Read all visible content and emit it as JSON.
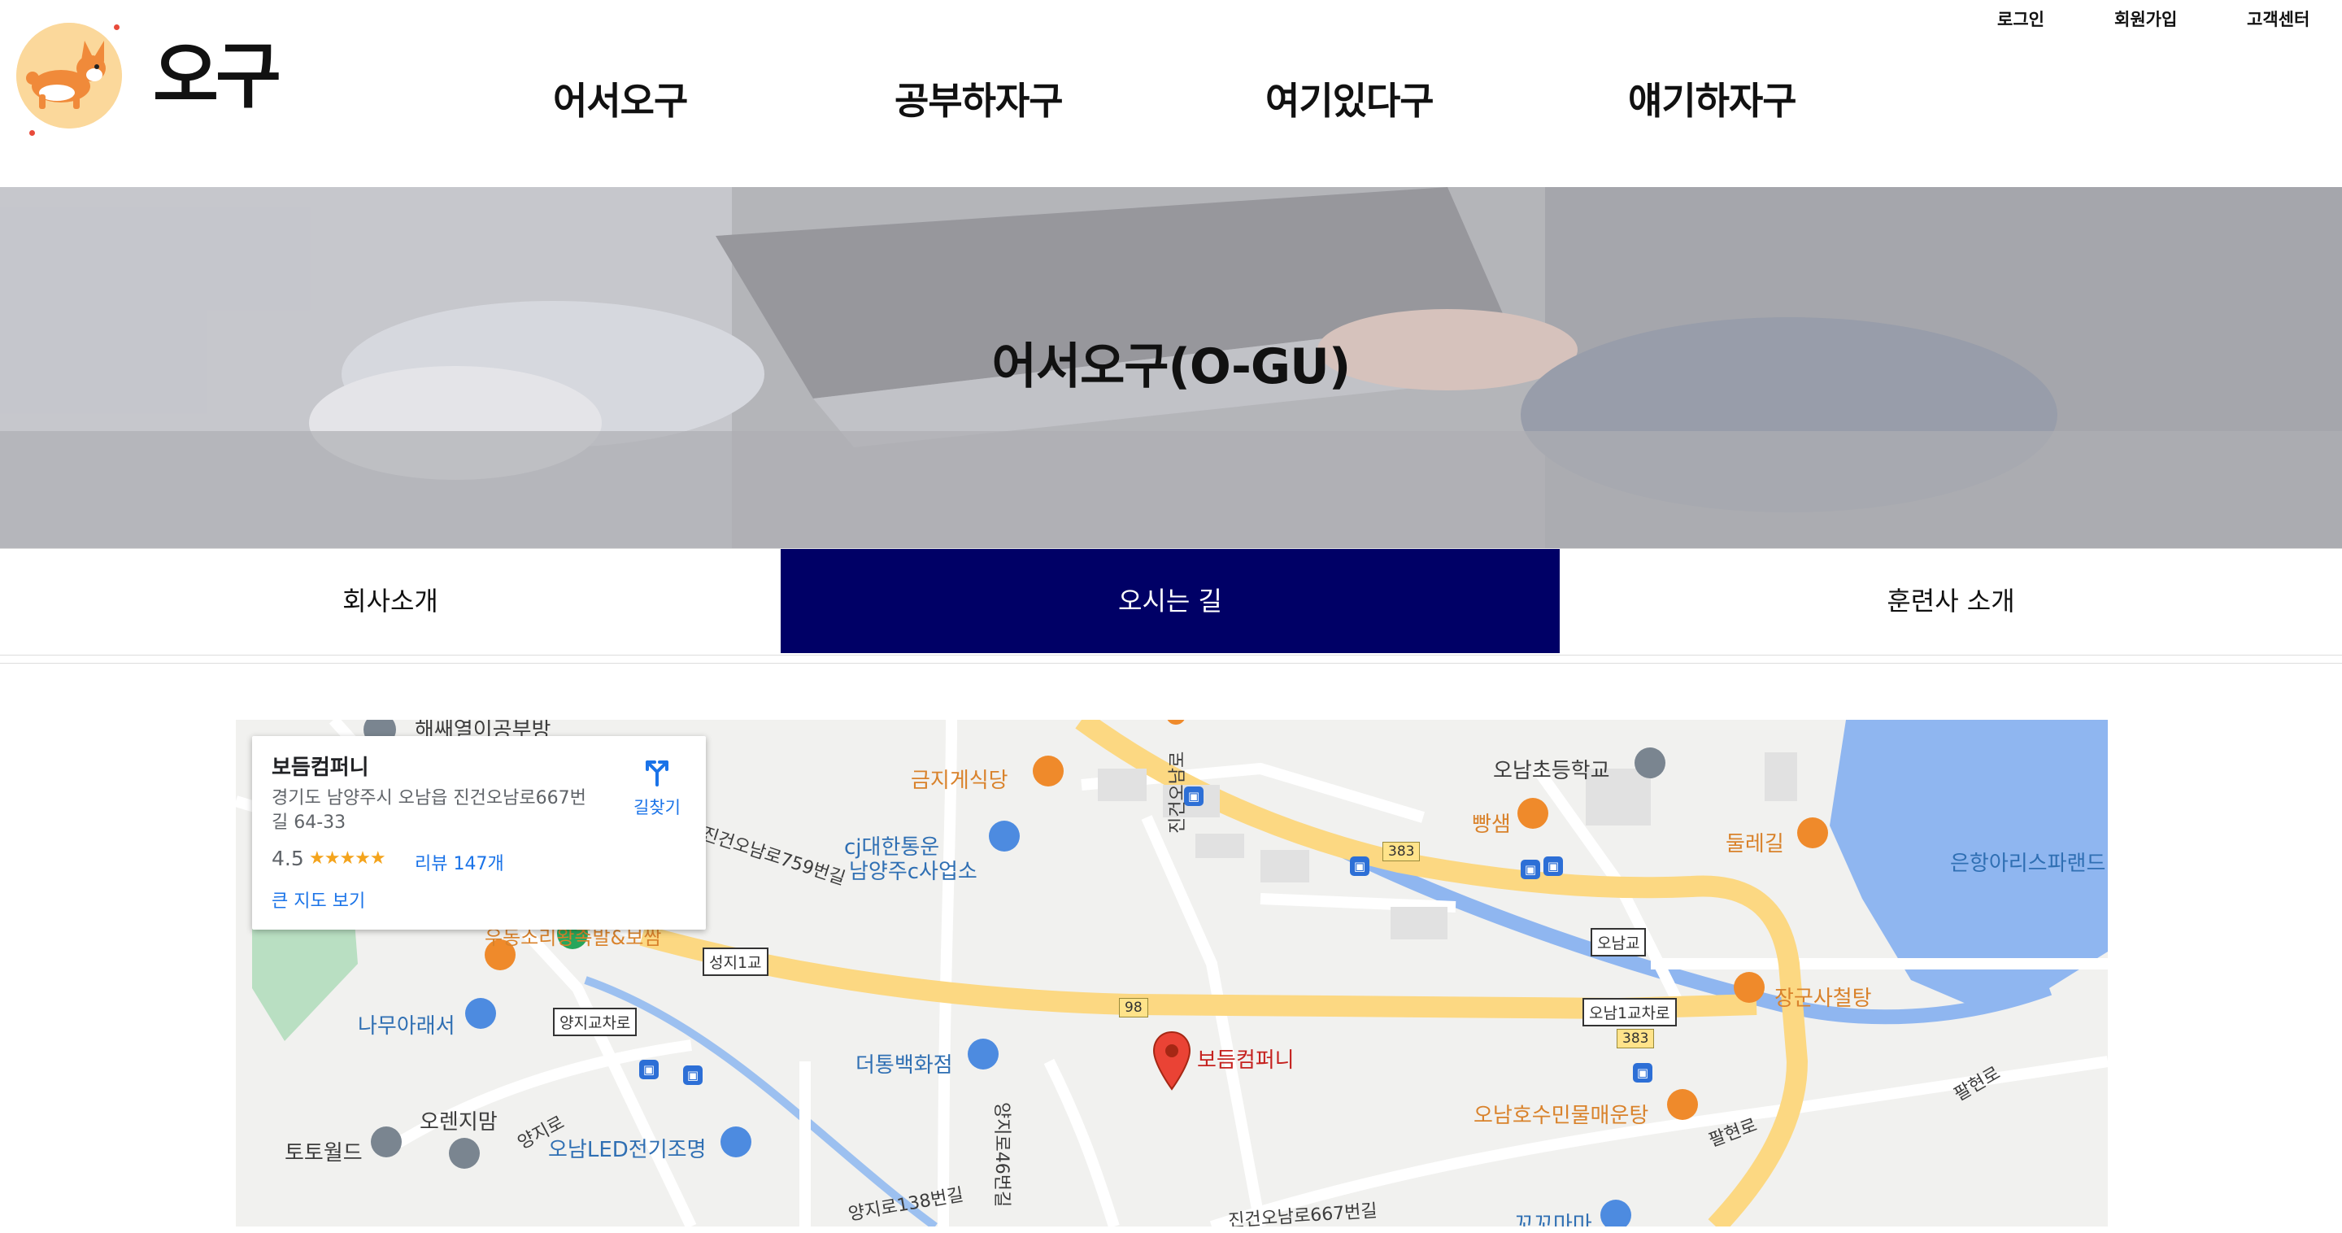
{
  "header": {
    "logo_text": "오구",
    "top_links": [
      "로그인",
      "회원가입",
      "고객센터"
    ],
    "nav": [
      "어서오구",
      "공부하자구",
      "여기있다구",
      "얘기하자구"
    ]
  },
  "banner": {
    "title": "어서오구(O-GU)"
  },
  "tabs": {
    "items": [
      "회사소개",
      "오시는 길",
      "훈련사 소개"
    ],
    "active_index": 1
  },
  "map": {
    "place_card": {
      "name": "보듬컴퍼니",
      "address": "경기도 남양주시 오남읍 진건오남로667번길 64-33",
      "rating": "4.5",
      "stars": "★★★★★",
      "reviews": "리뷰 147개",
      "big_map_link": "큰 지도 보기",
      "directions_label": "길찾기"
    },
    "labels": {
      "restaurant1": "금지게식당",
      "school": "오남초등학교",
      "bakery": "빵샘",
      "dullegil": "둘레길",
      "apartment": "은항아리스파랜드",
      "cj": "cj대한통운",
      "cj2": "남양주c사업소",
      "road759": "진건오남로759번길",
      "jingeon": "진건오남로",
      "namu": "나무아래서",
      "deotong": "더통백화점",
      "yangji46": "양지로46번길",
      "bodeum": "보듬컴퍼니",
      "janggun": "장군사철탕",
      "palhyeon": "팔현로",
      "palhyeon2": "팔현로",
      "onam_lake": "오남호수민물매운탕",
      "orenji": "오렌지맘",
      "toto": "토토월드",
      "yangjiro": "양지로",
      "led": "오남LED전기조명",
      "yangji138": "양지로138번길",
      "jingeon667": "진건오남로667번길",
      "kkokkoma": "꼬꼬마마",
      "partial_top": "해쌔열이공부방",
      "partial_left": "우동소리왕족발&보쌈"
    },
    "signs": [
      "성지1교",
      "양지교차로",
      "오남교",
      "오남1교차로"
    ],
    "route_numbers": [
      "383",
      "98",
      "383"
    ]
  },
  "colors": {
    "nav_active": "#000066",
    "link_blue": "#1a73e8",
    "road_yellow": "#fcd882",
    "water": "#8fb6f0"
  }
}
